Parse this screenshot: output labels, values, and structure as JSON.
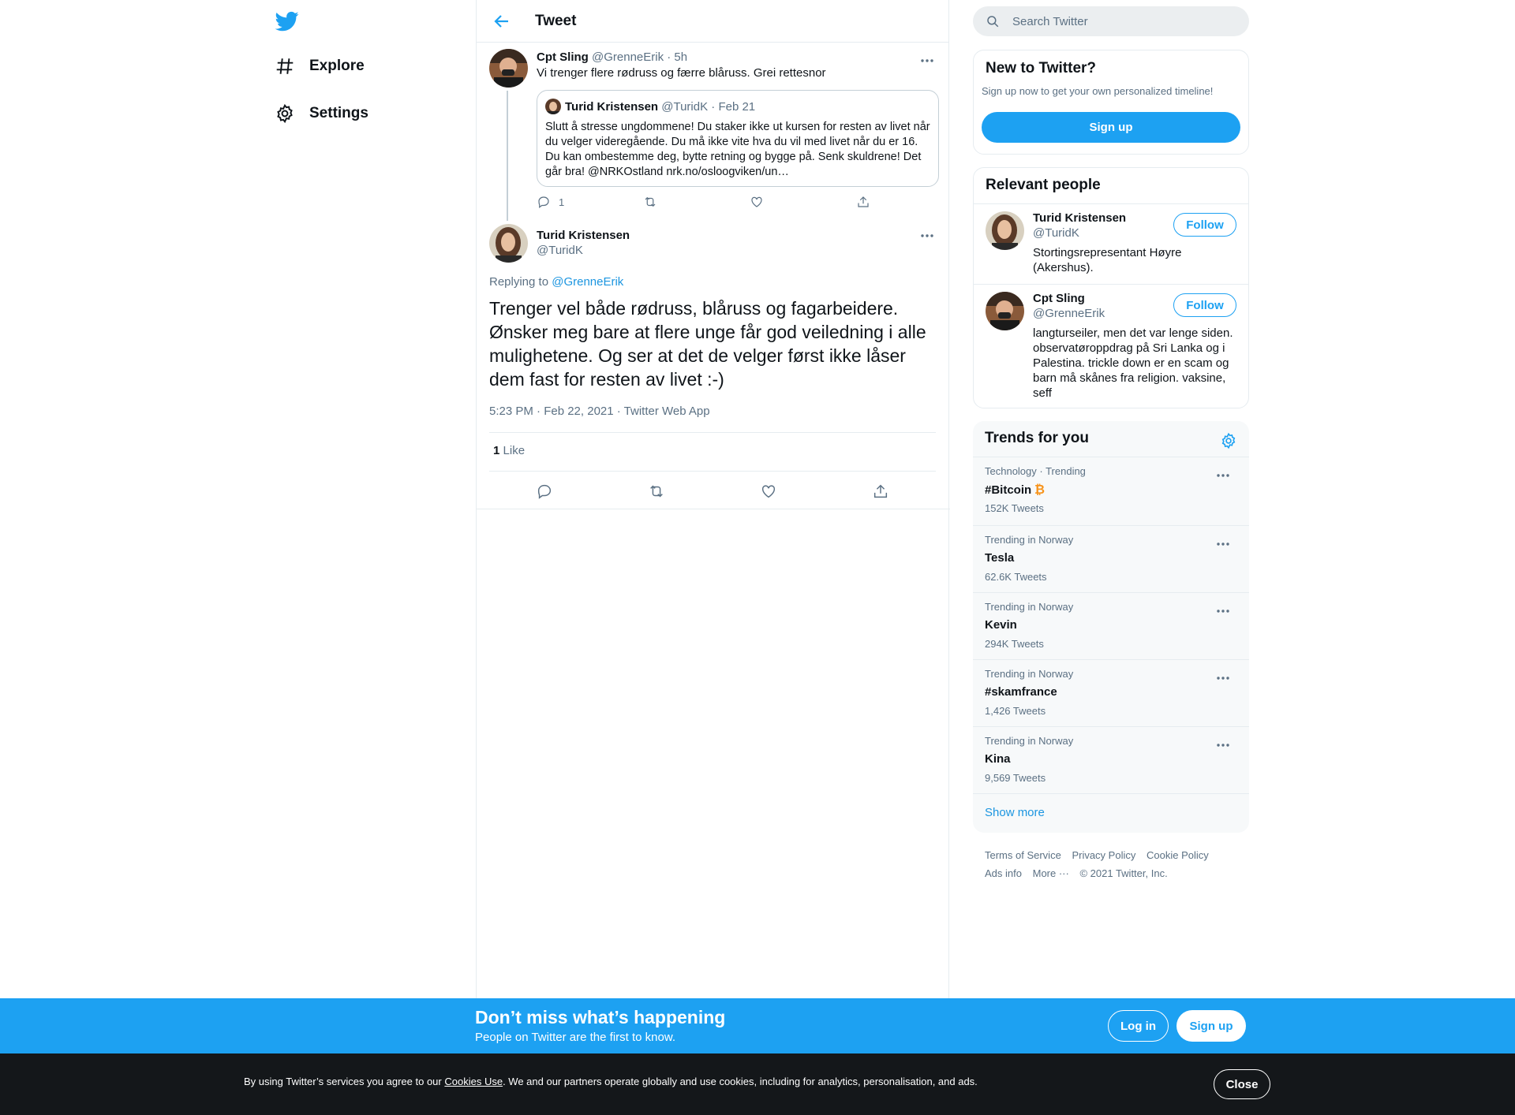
{
  "nav": {
    "logo_icon": "twitter-bird-icon",
    "items": [
      {
        "label": "Explore",
        "icon": "hashtag-icon"
      },
      {
        "label": "Settings",
        "icon": "gear-icon"
      }
    ]
  },
  "header": {
    "title": "Tweet"
  },
  "parent_tweet": {
    "name": "Cpt Sling",
    "handle": "@GrenneErik",
    "time": "· 5h",
    "text": "Vi trenger flere rødruss og færre blåruss. Grei rettesnor",
    "quote": {
      "name": "Turid Kristensen",
      "handle": "@TuridK",
      "date": "· Feb 21",
      "text": "Slutt å stresse ungdommene! Du staker ikke ut kursen for resten av livet når du velger videregående. Du må ikke vite hva du vil med livet når du er 16. Du kan ombestemme deg, bytte retning og bygge på. Senk skuldrene! Det går bra! @NRKOstland nrk.no/osloogviken/un…"
    },
    "reply_count": "1"
  },
  "main_tweet": {
    "name": "Turid Kristensen",
    "handle": "@TuridK",
    "replying_prefix": "Replying to",
    "replying_handle": "@GrenneErik",
    "text": "Trenger vel både rødruss, blåruss og fagarbeidere. Ønsker meg bare at flere unge får god veiledning i alle mulighetene. Og ser at det de velger først ikke låser dem fast for resten av livet :-)",
    "timestamp": "5:23 PM · Feb 22, 2021 · Twitter Web App",
    "like_count": "1",
    "like_label": "Like"
  },
  "search": {
    "placeholder": "Search Twitter"
  },
  "new_to_twitter": {
    "title": "New to Twitter?",
    "subtitle": "Sign up now to get your own personalized timeline!",
    "button": "Sign up"
  },
  "relevant_people": {
    "title": "Relevant people",
    "people": [
      {
        "name": "Turid Kristensen",
        "handle": "@TuridK",
        "bio": "Stortingsrepresentant Høyre (Akershus).",
        "button": "Follow"
      },
      {
        "name": "Cpt Sling",
        "handle": "@GrenneErik",
        "bio": "langturseiler, men det var lenge siden. observatøroppdrag på Sri Lanka og i Palestina. trickle down er en scam og barn må skånes fra religion. vaksine, seff",
        "button": "Follow"
      }
    ]
  },
  "trends": {
    "title": "Trends for you",
    "items": [
      {
        "category": "Technology · Trending",
        "name": "#Bitcoin",
        "count": "152K Tweets"
      },
      {
        "category": "Trending in Norway",
        "name": "Tesla",
        "count": "62.6K Tweets"
      },
      {
        "category": "Trending in Norway",
        "name": "Kevin",
        "count": "294K Tweets"
      },
      {
        "category": "Trending in Norway",
        "name": "#skamfrance",
        "count": "1,426 Tweets"
      },
      {
        "category": "Trending in Norway",
        "name": "Kina",
        "count": "9,569 Tweets"
      }
    ],
    "show_more": "Show more"
  },
  "footer": {
    "terms": "Terms of Service",
    "privacy": "Privacy Policy",
    "cookie": "Cookie Policy",
    "ads": "Ads info",
    "more": "More ···",
    "copyright": "© 2021 Twitter, Inc."
  },
  "banner": {
    "title": "Don’t miss what’s happening",
    "subtitle": "People on Twitter are the first to know.",
    "login": "Log in",
    "signup": "Sign up"
  },
  "cookie_bar": {
    "prefix": "By using Twitter’s services you agree to our",
    "link": "Cookies Use",
    "suffix": ". We and our partners operate globally and use cookies, including for analytics, personalisation, and ads.",
    "close": "Close"
  },
  "colors": {
    "accent": "#1da1f2",
    "text": "#0f1419",
    "muted": "#5b7083",
    "border": "#e6ecf0",
    "cookie_bg": "#14171a"
  }
}
